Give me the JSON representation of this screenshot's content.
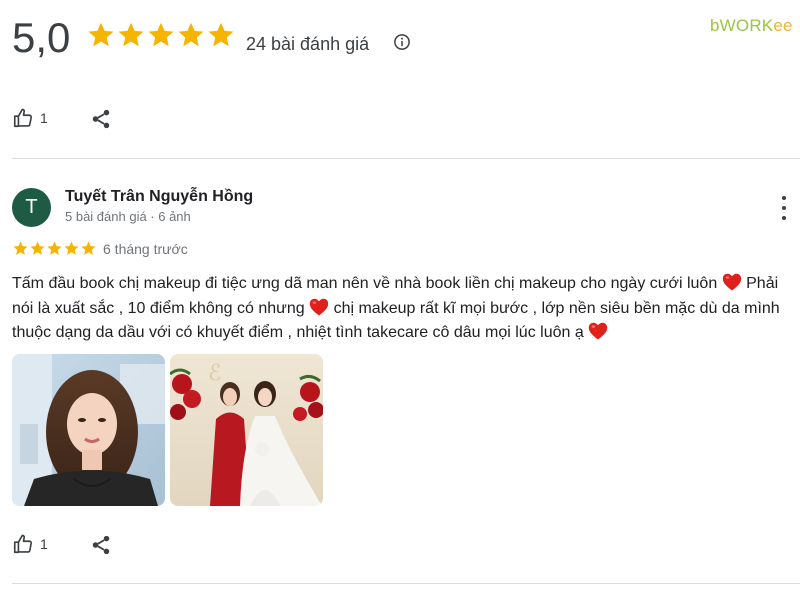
{
  "summary": {
    "rating": "5,0",
    "stars": 5,
    "review_count_label": "24 bài đánh giá",
    "info_icon": "info-icon"
  },
  "brand": {
    "part1": "bWORK",
    "part2": "ee",
    "color1": "#9bc53d",
    "color2": "#f2b233"
  },
  "top_actions": {
    "like_count": "1",
    "like_icon": "thumbs-up-icon",
    "share_icon": "share-icon"
  },
  "review": {
    "avatar_letter": "T",
    "avatar_color": "#1e5b45",
    "reviewer_name": "Tuyết Trân Nguyễn Hồng",
    "reviewer_meta": "5 bài đánh giá · 6 ảnh",
    "stars": 5,
    "time_ago": "6 tháng trước",
    "text_seg1": "Tấm đầu book chị makeup đi tiệc ưng dã man nên về nhà book liền chị makeup cho ngày cưới luôn ",
    "text_seg2": " Phải nói là xuất sắc , 10 điểm không có nhưng ",
    "text_seg3": " chị makeup rất kĩ mọi bước , lớp nền siêu bền mặc dù da mình thuộc dạng da dầu với có khuyết điểm , nhiệt tình takecare cô dâu mọi lúc luôn ạ ",
    "heart_icon": "red-heart-icon",
    "photos": [
      {
        "name": "portrait-photo"
      },
      {
        "name": "bride-photo"
      }
    ],
    "like_count": "1"
  },
  "colors": {
    "star": "#f4b400",
    "heart": "#e0201b",
    "text_secondary": "#70757a"
  }
}
